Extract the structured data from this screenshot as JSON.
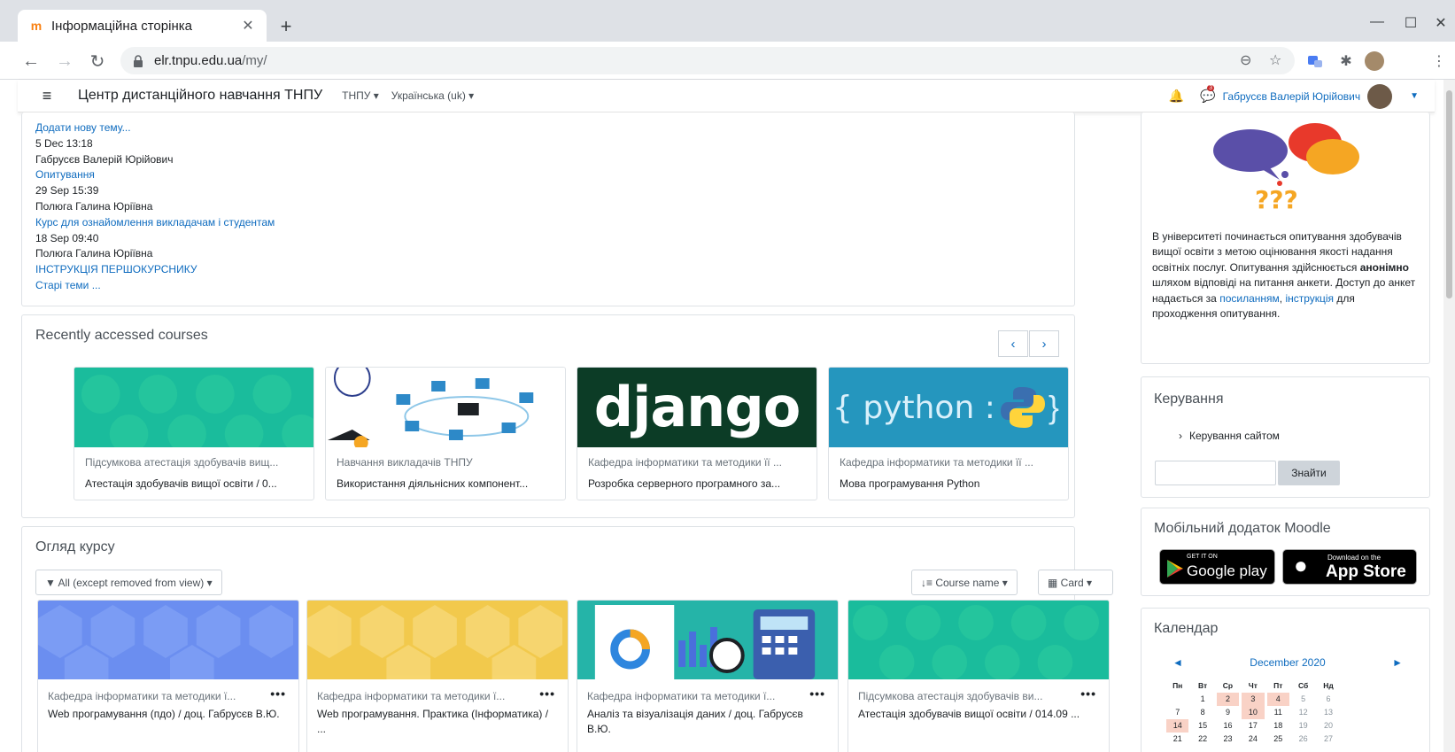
{
  "browser": {
    "tab_title": "Інформаційна сторінка",
    "tab_favicon": "moodle-favicon",
    "url_host": "elr.tnpu.edu.ua",
    "url_path": "/my/"
  },
  "navbar": {
    "site_name": "Центр дистанційного навчання ТНПУ",
    "menu_tnpu": "ТНПУ ▾",
    "menu_lang": "Українська (uk) ▾",
    "user_name": "Габрусєв Валерій Юрійович",
    "message_badge": "3"
  },
  "forum": {
    "lines": [
      {
        "text": "Додати нову тему...",
        "link": true
      },
      {
        "text": "5 Dec 13:18",
        "link": false
      },
      {
        "text": "Габрусєв Валерій Юрійович",
        "link": false
      },
      {
        "text": "Опитування",
        "link": true
      },
      {
        "text": "29 Sep 15:39",
        "link": false
      },
      {
        "text": "Полюга Галина Юріївна",
        "link": false
      },
      {
        "text": "Курс для ознайомлення викладачам і студентам",
        "link": true
      },
      {
        "text": "18 Sep 09:40",
        "link": false
      },
      {
        "text": "Полюга Галина Юріївна",
        "link": false
      },
      {
        "text": "ІНСТРУКЦІЯ ПЕРШОКУРСНИКУ",
        "link": true
      },
      {
        "text": "Старі теми ...",
        "link": true
      }
    ]
  },
  "recent": {
    "title": "Recently accessed courses",
    "prev": "‹",
    "next": "›",
    "courses": [
      {
        "category": "Підсумкова атестація здобувачів вищ...",
        "name": "Атестація здобувачів вищої освіти / 0...",
        "image": "teal-hexagons"
      },
      {
        "category": "Навчання викладачів ТНПУ",
        "name": "Використання діяльнісних компонент...",
        "image": "network-illustration"
      },
      {
        "category": "Кафедра інформатики та методики її ...",
        "name": "Розробка серверного програмного за...",
        "image": "django-logo",
        "logo_text": "django"
      },
      {
        "category": "Кафедра інформатики та методики її ...",
        "name": "Мова програмування Python",
        "image": "python-logo",
        "logo_text": "{ python :"
      }
    ]
  },
  "overview": {
    "title": "Огляд курсу",
    "filter": "▼ All (except removed from view) ▾",
    "sort": "↓≡ Course name ▾",
    "view": "▦ Card ▾",
    "more": "•••",
    "courses": [
      {
        "category": "Кафедра інформатики та методики ї...",
        "name": "Web програмування (пдо) / доц. Габрусєв В.Ю.",
        "image": "blue-hexagons"
      },
      {
        "category": "Кафедра інформатики та методики ї...",
        "name": "Web програмування. Практика (Інформатика) / ...",
        "image": "yellow-hexagons"
      },
      {
        "category": "Кафедра інформатики та методики ї...",
        "name": "Аналіз та візуалізація даних / доц. Габрусєв В.Ю.",
        "image": "data-illustration"
      },
      {
        "category": "Підсумкова атестація здобувачів ви...",
        "name": "Атестація здобувачів вищої освіти / 014.09 ...",
        "image": "teal-circles"
      }
    ]
  },
  "survey": {
    "question_marks": "???",
    "text_before_bold": "В університеті починається  опитування здобувачів вищої освіти  з метою оцінювання якості надання освітніх послуг. Опитування здійснюється ",
    "bold": "анонімно",
    "text_after_bold": " шляхом відповіді на питання анкети. Доступ до анкет надається за ",
    "link1": "посиланням",
    "sep": ", ",
    "link2": "інструкція",
    "text_end": " для проходження опитування."
  },
  "manage": {
    "title": "Керування",
    "item": "Керування сайтом",
    "search_button": "Знайти",
    "search_value": ""
  },
  "mobile": {
    "title": "Мобільний додаток Moodle",
    "google_small": "GET IT ON",
    "google_big": "Google play",
    "apple_small": "Download on the",
    "apple_big": "App Store"
  },
  "calendar": {
    "title": "Календар",
    "month": "December 2020",
    "prev": "◄",
    "next": "►",
    "days_of_week": [
      "Пн",
      "Вт",
      "Ср",
      "Чт",
      "Пт",
      "Сб",
      "Нд"
    ],
    "weeks": [
      [
        "",
        "1",
        "2",
        "3",
        "4",
        "5",
        "6"
      ],
      [
        "7",
        "8",
        "9",
        "10",
        "11",
        "12",
        "13"
      ],
      [
        "14",
        "15",
        "16",
        "17",
        "18",
        "19",
        "20"
      ],
      [
        "21",
        "22",
        "23",
        "24",
        "25",
        "26",
        "27"
      ]
    ],
    "event_days": [
      "2",
      "3",
      "4",
      "10",
      "14"
    ]
  },
  "colors": {
    "link": "#0f6cbf",
    "brand_orange": "#f98012",
    "teal": "#1abc9c",
    "event_bg": "#f9d2c6"
  }
}
